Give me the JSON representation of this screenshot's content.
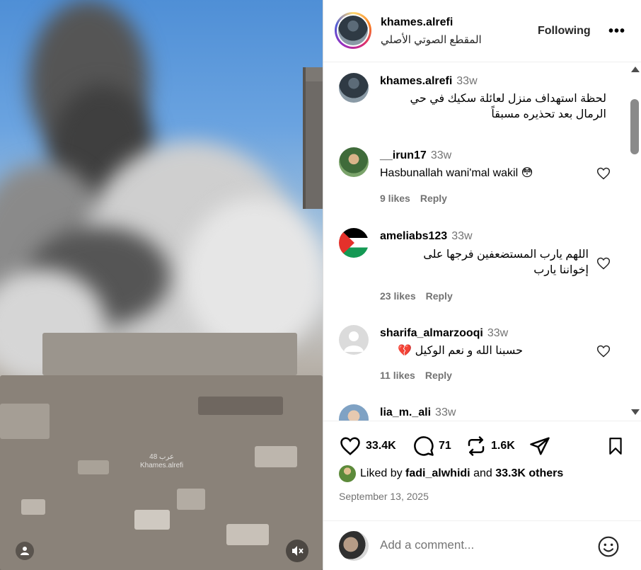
{
  "media": {
    "watermark_line1": "عرب 48",
    "watermark_line2": "Khames.alrefi",
    "user_icon": "person-icon",
    "mute_icon": "speaker-muted-icon"
  },
  "header": {
    "username": "khames.alrefi",
    "audio": "المقطع الصوتي الأصلي",
    "follow_label": "Following",
    "more_label": "•••"
  },
  "comments": [
    {
      "user": "khames.alrefi",
      "time": "33w",
      "text_line1": "لحظة استهداف منزل لعائلة سكيك في حي",
      "text_line2": "الرمال بعد تحذيره مسبقاً",
      "is_caption": true
    },
    {
      "user": "__irun17",
      "time": "33w",
      "text": "Hasbunallah wani'mal wakil 😳",
      "likes": "9 likes",
      "reply": "Reply"
    },
    {
      "user": "ameliabs123",
      "time": "33w",
      "text_line1": "اللهم يارب المستضعفين فرجها على",
      "text_line2": "إخواننا يارب",
      "likes": "23 likes",
      "reply": "Reply"
    },
    {
      "user": "sharifa_almarzooqi",
      "time": "33w",
      "text": "حسبنا الله و نعم الوكيل 💔",
      "likes": "11 likes",
      "reply": "Reply"
    },
    {
      "user": "lia_m._ali",
      "time": "33w"
    }
  ],
  "actions": {
    "like_count": "33.4K",
    "comment_count": "71",
    "repost_count": "1.6K",
    "liked_by_prefix": "Liked by",
    "liked_by_user": "fadi_alwhidi",
    "liked_by_and": "and",
    "liked_by_others": "33.3K others",
    "date": "September 13, 2025"
  },
  "comment_box": {
    "placeholder": "Add a comment..."
  },
  "colors": {
    "secondary_text": "#737373",
    "border": "#efefef",
    "sky": "#4f8fd6"
  }
}
